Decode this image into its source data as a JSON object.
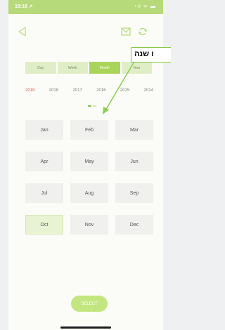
{
  "status_bar": {
    "time": "10:18 ↗",
    "icons": "•ıl ᯤ ▬"
  },
  "callout": {
    "text": "ו שנה"
  },
  "tabs": [
    {
      "label": "Day",
      "active": false
    },
    {
      "label": "Week",
      "active": false
    },
    {
      "label": "Month",
      "active": true
    },
    {
      "label": "Year",
      "active": false
    }
  ],
  "years": [
    "2019",
    "2018",
    "2017",
    "2016",
    "2015",
    "2014"
  ],
  "current_year": "2019",
  "months": [
    "Jan",
    "Feb",
    "Mar",
    "Apr",
    "May",
    "Jun",
    "Jul",
    "Aug",
    "Sep",
    "Oct",
    "Nov",
    "Dec"
  ],
  "selected_month": "Oct",
  "select_button": {
    "label": "SELECT"
  },
  "icons": {
    "back": "back-arrow-icon",
    "mail": "mail-icon",
    "refresh": "refresh-icon"
  },
  "colors": {
    "accent": "#a9d45a",
    "status_bar": "#b6d97a",
    "current_year": "#e05a52",
    "callout_border": "#7fc63a"
  }
}
